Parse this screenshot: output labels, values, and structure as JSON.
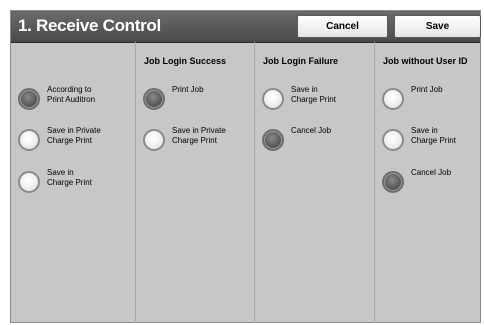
{
  "title": "1. Receive Control",
  "buttons": {
    "cancel": "Cancel",
    "save": "Save"
  },
  "columns": [
    {
      "header": "",
      "options": [
        {
          "label": "According to\nPrint Auditron",
          "selected": true
        },
        {
          "label": "Save in Private\nCharge Print",
          "selected": false
        },
        {
          "label": "Save in\nCharge Print",
          "selected": false
        }
      ]
    },
    {
      "header": "Job Login Success",
      "options": [
        {
          "label": "Print Job",
          "selected": true
        },
        {
          "label": "Save in Private\nCharge Print",
          "selected": false
        }
      ]
    },
    {
      "header": "Job Login Failure",
      "options": [
        {
          "label": "Save in\nCharge Print",
          "selected": false
        },
        {
          "label": "Cancel Job",
          "selected": true
        }
      ]
    },
    {
      "header": "Job without User ID",
      "options": [
        {
          "label": "Print Job",
          "selected": false
        },
        {
          "label": "Save in\nCharge Print",
          "selected": false
        },
        {
          "label": "Cancel Job",
          "selected": true
        }
      ]
    }
  ]
}
